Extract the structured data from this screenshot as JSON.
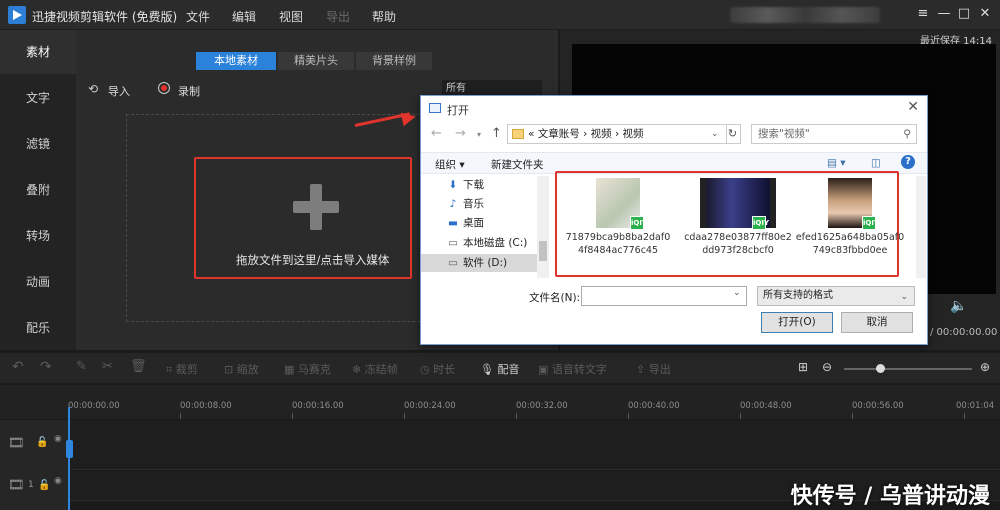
{
  "app": {
    "title": "迅捷视频剪辑软件 (免费版)",
    "menu": [
      "文件",
      "编辑",
      "视图",
      "导出",
      "帮助"
    ],
    "window_controls": [
      "≡",
      "—",
      "□",
      "✕"
    ]
  },
  "left_nav": {
    "items": [
      "素材",
      "文字",
      "滤镜",
      "叠附",
      "转场",
      "动画",
      "配乐"
    ],
    "active_index": 0
  },
  "media": {
    "tabs": [
      "本地素材",
      "精美片头",
      "背景样例"
    ],
    "import_label": "导入",
    "record_label": "录制",
    "filter_value": "所有",
    "drop_text": "拖放文件到这里/点击导入媒体"
  },
  "preview": {
    "last_save": "最近保存 14:14",
    "time": "/ 00:00:00.00"
  },
  "toolbar": {
    "tools": [
      "裁剪",
      "缩放",
      "马赛克",
      "冻结帧",
      "时长",
      "配音",
      "语音转文字",
      "导出"
    ],
    "enabled": [
      "配音"
    ]
  },
  "timeline": {
    "ticks": [
      "00:00:00.00",
      "00:00:08.00",
      "00:00:16.00",
      "00:00:24.00",
      "00:00:32.00",
      "00:00:40.00",
      "00:00:48.00",
      "00:00:56.00",
      "00:01:04"
    ],
    "track2_label": "1"
  },
  "dialog": {
    "title": "打开",
    "breadcrumb": "« 文章账号 › 视频 › 视频",
    "search_placeholder": "搜索\"视频\"",
    "organize": "组织 ▾",
    "new_folder": "新建文件夹",
    "nav_items": [
      {
        "label": "下载",
        "icon": "download-icon"
      },
      {
        "label": "音乐",
        "icon": "music-icon"
      },
      {
        "label": "桌面",
        "icon": "desktop-icon"
      },
      {
        "label": "本地磁盘 (C:)",
        "icon": "disk-icon"
      },
      {
        "label": "软件 (D:)",
        "icon": "disk-icon"
      }
    ],
    "files": [
      {
        "name": "71879bca9b8ba2daf04f8484ac776c45",
        "badge": "iQIY"
      },
      {
        "name": "cdaa278e03877ff80e2dd973f28cbcf0",
        "badge": "iQIY"
      },
      {
        "name": "efed1625a648ba05af0749c83fbbd0ee",
        "badge": "iQIY"
      }
    ],
    "filename_label": "文件名(N):",
    "filetype": "所有支持的格式",
    "open_button": "打开(O)",
    "cancel_button": "取消"
  },
  "watermark": "快传号 / 乌普讲动漫",
  "colors": {
    "accent": "#2a82da",
    "highlight": "#e0342c",
    "badge": "#2bb24c"
  }
}
